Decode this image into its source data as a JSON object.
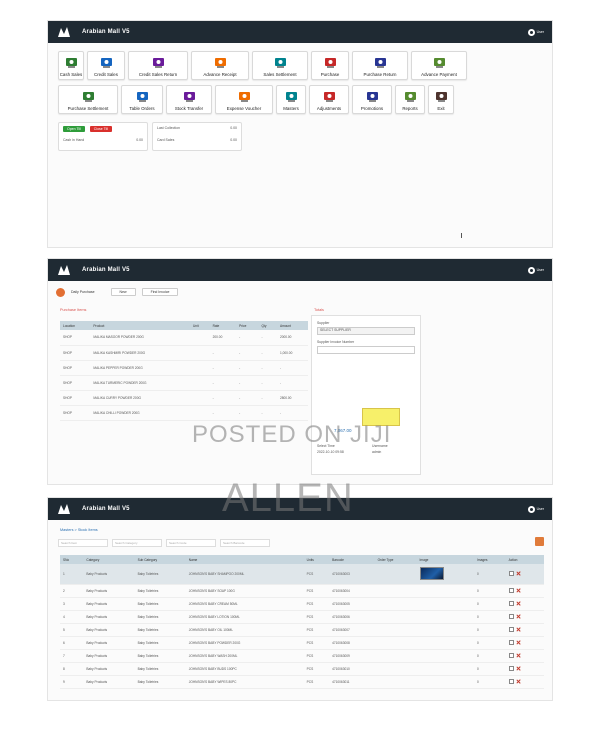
{
  "app": {
    "title": "Arabian Mall V5",
    "user": "User"
  },
  "watermark": {
    "line1": "POSTED ON JIJI",
    "line2": "ALLEN"
  },
  "dashboard": {
    "tiles_row1": [
      {
        "label": "Cash Sales",
        "icon": "cash-icon"
      },
      {
        "label": "Credit Sales",
        "icon": "register-icon"
      },
      {
        "label": "Credit Sales Return",
        "icon": "return-icon"
      },
      {
        "label": "Advance Receipt",
        "icon": "receipt-icon"
      },
      {
        "label": "Sales Settlement",
        "icon": "settlement-icon"
      },
      {
        "label": "Purchase",
        "icon": "purchase-icon"
      },
      {
        "label": "Purchase Return",
        "icon": "purchase-return-icon"
      },
      {
        "label": "Advance Payment",
        "icon": "payment-icon"
      }
    ],
    "tiles_row2": [
      {
        "label": "Purchase Settlement",
        "icon": "purchase-settlement-icon"
      },
      {
        "label": "Table Orders",
        "icon": "table-icon"
      },
      {
        "label": "Stock Transfer",
        "icon": "transfer-icon"
      },
      {
        "label": "Expense Voucher",
        "icon": "voucher-icon"
      },
      {
        "label": "Masters",
        "icon": "masters-icon"
      },
      {
        "label": "Adjustments",
        "icon": "adjust-icon"
      },
      {
        "label": "Promotions",
        "icon": "promotion-icon"
      },
      {
        "label": "Reports",
        "icon": "reports-icon"
      },
      {
        "label": "Exit",
        "icon": "exit-icon"
      }
    ],
    "shift": {
      "open_label": "Open Till",
      "close_label": "Close Till",
      "cash_label": "Cash in Hand",
      "cash_value": "0.00"
    },
    "collections": {
      "last_label": "Last Collection",
      "last_value": "0.00",
      "card_label": "Card Sales",
      "card_value": "0.00"
    }
  },
  "sales_screen": {
    "breadcrumb": "Daily Purchase",
    "new_label": "New",
    "find_label": "Find Invoice",
    "section_items": "Purchase Items",
    "section_totals": "Totals",
    "columns": [
      "Location",
      "Product",
      "Unit",
      "Rate",
      "Price",
      "Qty",
      "Amount"
    ],
    "rows": [
      [
        "SHOP",
        "MALIKA MASOOR POWDER 200G",
        "",
        "200.00",
        "-",
        "-",
        "2000.00"
      ],
      [
        "SHOP",
        "MALIKA KASHMIRI POWDER 200G",
        "",
        "-",
        "-",
        "-",
        "1,000.00"
      ],
      [
        "SHOP",
        "MALIKA PEPPER POWDER 200G",
        "",
        "-",
        "-",
        "-",
        "-"
      ],
      [
        "SHOP",
        "MALIKA TURMERIC POWDER 200G",
        "",
        "-",
        "-",
        "-",
        "-"
      ],
      [
        "SHOP",
        "MALIKA CURRY POWDER 200G",
        "",
        "-",
        "-",
        "-",
        "2800.00"
      ],
      [
        "SHOP",
        "MALIKA CHILLI POWDER 200G",
        "",
        "-",
        "-",
        "-",
        "-"
      ]
    ],
    "side": {
      "supplier_label": "Supplier",
      "supplier_value": "SELECT SUPPLIER",
      "invoice_label": "Supplier Invoice Number",
      "total_value": "7,067.00",
      "time_label": "Select Time",
      "time_value": "2022-10-10 09:58",
      "user_label": "Username",
      "user_value": "admin"
    }
  },
  "masters_screen": {
    "breadcrumb": "Masters > Stock Items",
    "filters": [
      "Search Item",
      "Search Category",
      "Search Code",
      "Search Barcode"
    ],
    "columns": [
      "SNo",
      "Category",
      "Sub Category",
      "Name",
      "Units",
      "Barcode",
      "Order Type",
      "Image",
      "Images",
      "Action"
    ],
    "rows": [
      [
        "1",
        "Baby Products",
        "Baby Toiletries",
        "JOHNSON'S BABY SHAMPOO 200ML",
        "PCS",
        "4710063003",
        "",
        "image",
        "0"
      ],
      [
        "2",
        "Baby Products",
        "Baby Toiletries",
        "JOHNSON'S BABY SOAP 100G",
        "PCS",
        "4710063004",
        "",
        "",
        "0"
      ],
      [
        "3",
        "Baby Products",
        "Baby Toiletries",
        "JOHNSON'S BABY CREAM 50ML",
        "PCS",
        "4710063005",
        "",
        "",
        "0"
      ],
      [
        "4",
        "Baby Products",
        "Baby Toiletries",
        "JOHNSON'S BABY LOTION 100ML",
        "PCS",
        "4710063006",
        "",
        "",
        "0"
      ],
      [
        "5",
        "Baby Products",
        "Baby Toiletries",
        "JOHNSON'S BABY OIL 100ML",
        "PCS",
        "4710063007",
        "",
        "",
        "0"
      ],
      [
        "6",
        "Baby Products",
        "Baby Toiletries",
        "JOHNSON'S BABY POWDER 200G",
        "PCS",
        "4710063008",
        "",
        "",
        "0"
      ],
      [
        "7",
        "Baby Products",
        "Baby Toiletries",
        "JOHNSON'S BABY WASH 200ML",
        "PCS",
        "4710063009",
        "",
        "",
        "0"
      ],
      [
        "8",
        "Baby Products",
        "Baby Toiletries",
        "JOHNSON'S BABY BUDS 100PC",
        "PCS",
        "4710063010",
        "",
        "",
        "0"
      ],
      [
        "9",
        "Baby Products",
        "Baby Toiletries",
        "JOHNSON'S BABY WIPES 80PC",
        "PCS",
        "4710063011",
        "",
        "",
        "0"
      ]
    ]
  },
  "colors": {
    "titlebar": "#1f2a33",
    "header_row": "#c7d6de",
    "accent_orange": "#e26f33",
    "green": "#2e9c3a",
    "red": "#d9302c"
  }
}
